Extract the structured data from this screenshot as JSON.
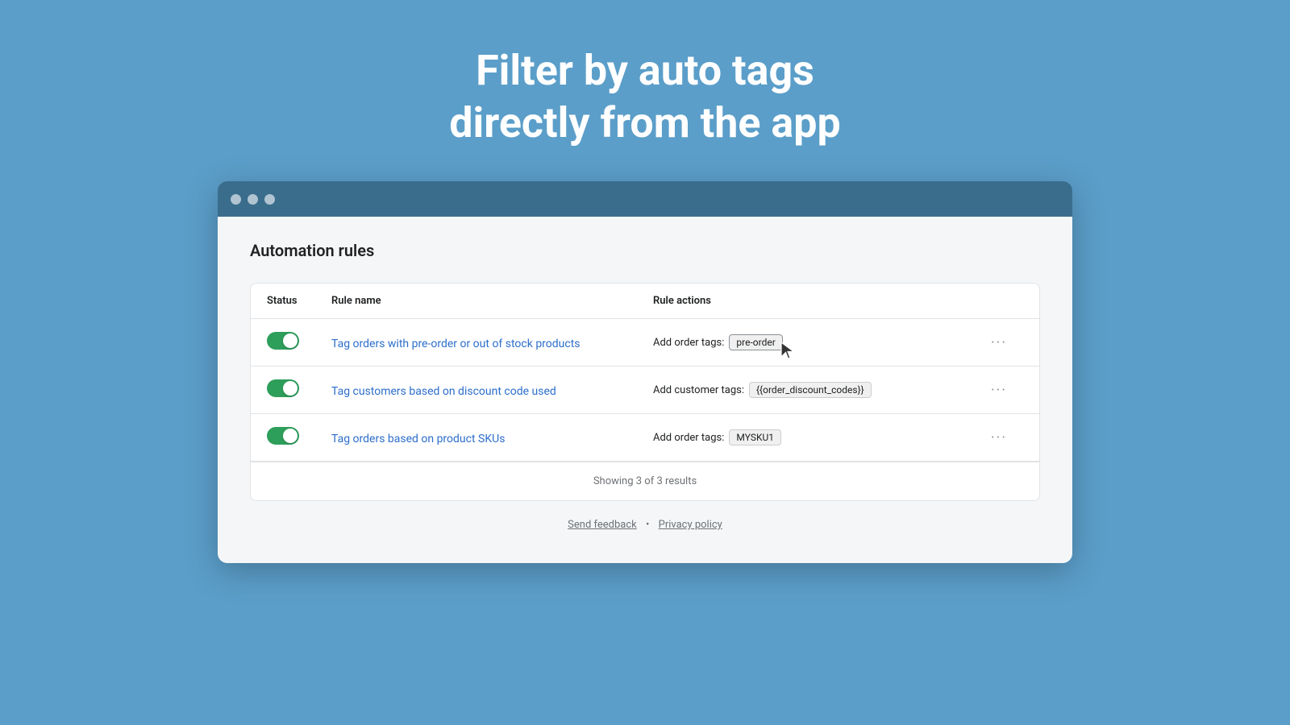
{
  "hero": {
    "line1": "Filter by auto tags",
    "line2": "directly from the app"
  },
  "browser": {
    "dots": [
      "dot1",
      "dot2",
      "dot3"
    ]
  },
  "page": {
    "title": "Automation rules"
  },
  "table": {
    "headers": {
      "status": "Status",
      "rule_name": "Rule name",
      "rule_actions": "Rule actions"
    },
    "rows": [
      {
        "id": 1,
        "enabled": true,
        "rule_name": "Tag orders with pre-order or out of stock products",
        "actions_label": "Add order tags:",
        "tag": "pre-order",
        "highlighted": true
      },
      {
        "id": 2,
        "enabled": true,
        "rule_name": "Tag customers based on discount code used",
        "actions_label": "Add customer tags:",
        "tag": "{{order_discount_codes}}",
        "highlighted": false
      },
      {
        "id": 3,
        "enabled": true,
        "rule_name": "Tag orders based on product SKUs",
        "actions_label": "Add order tags:",
        "tag": "MYSKU1",
        "highlighted": false
      }
    ],
    "footer": "Showing 3 of 3 results"
  },
  "footer": {
    "send_feedback": "Send feedback",
    "separator": "•",
    "privacy_policy": "Privacy policy"
  }
}
